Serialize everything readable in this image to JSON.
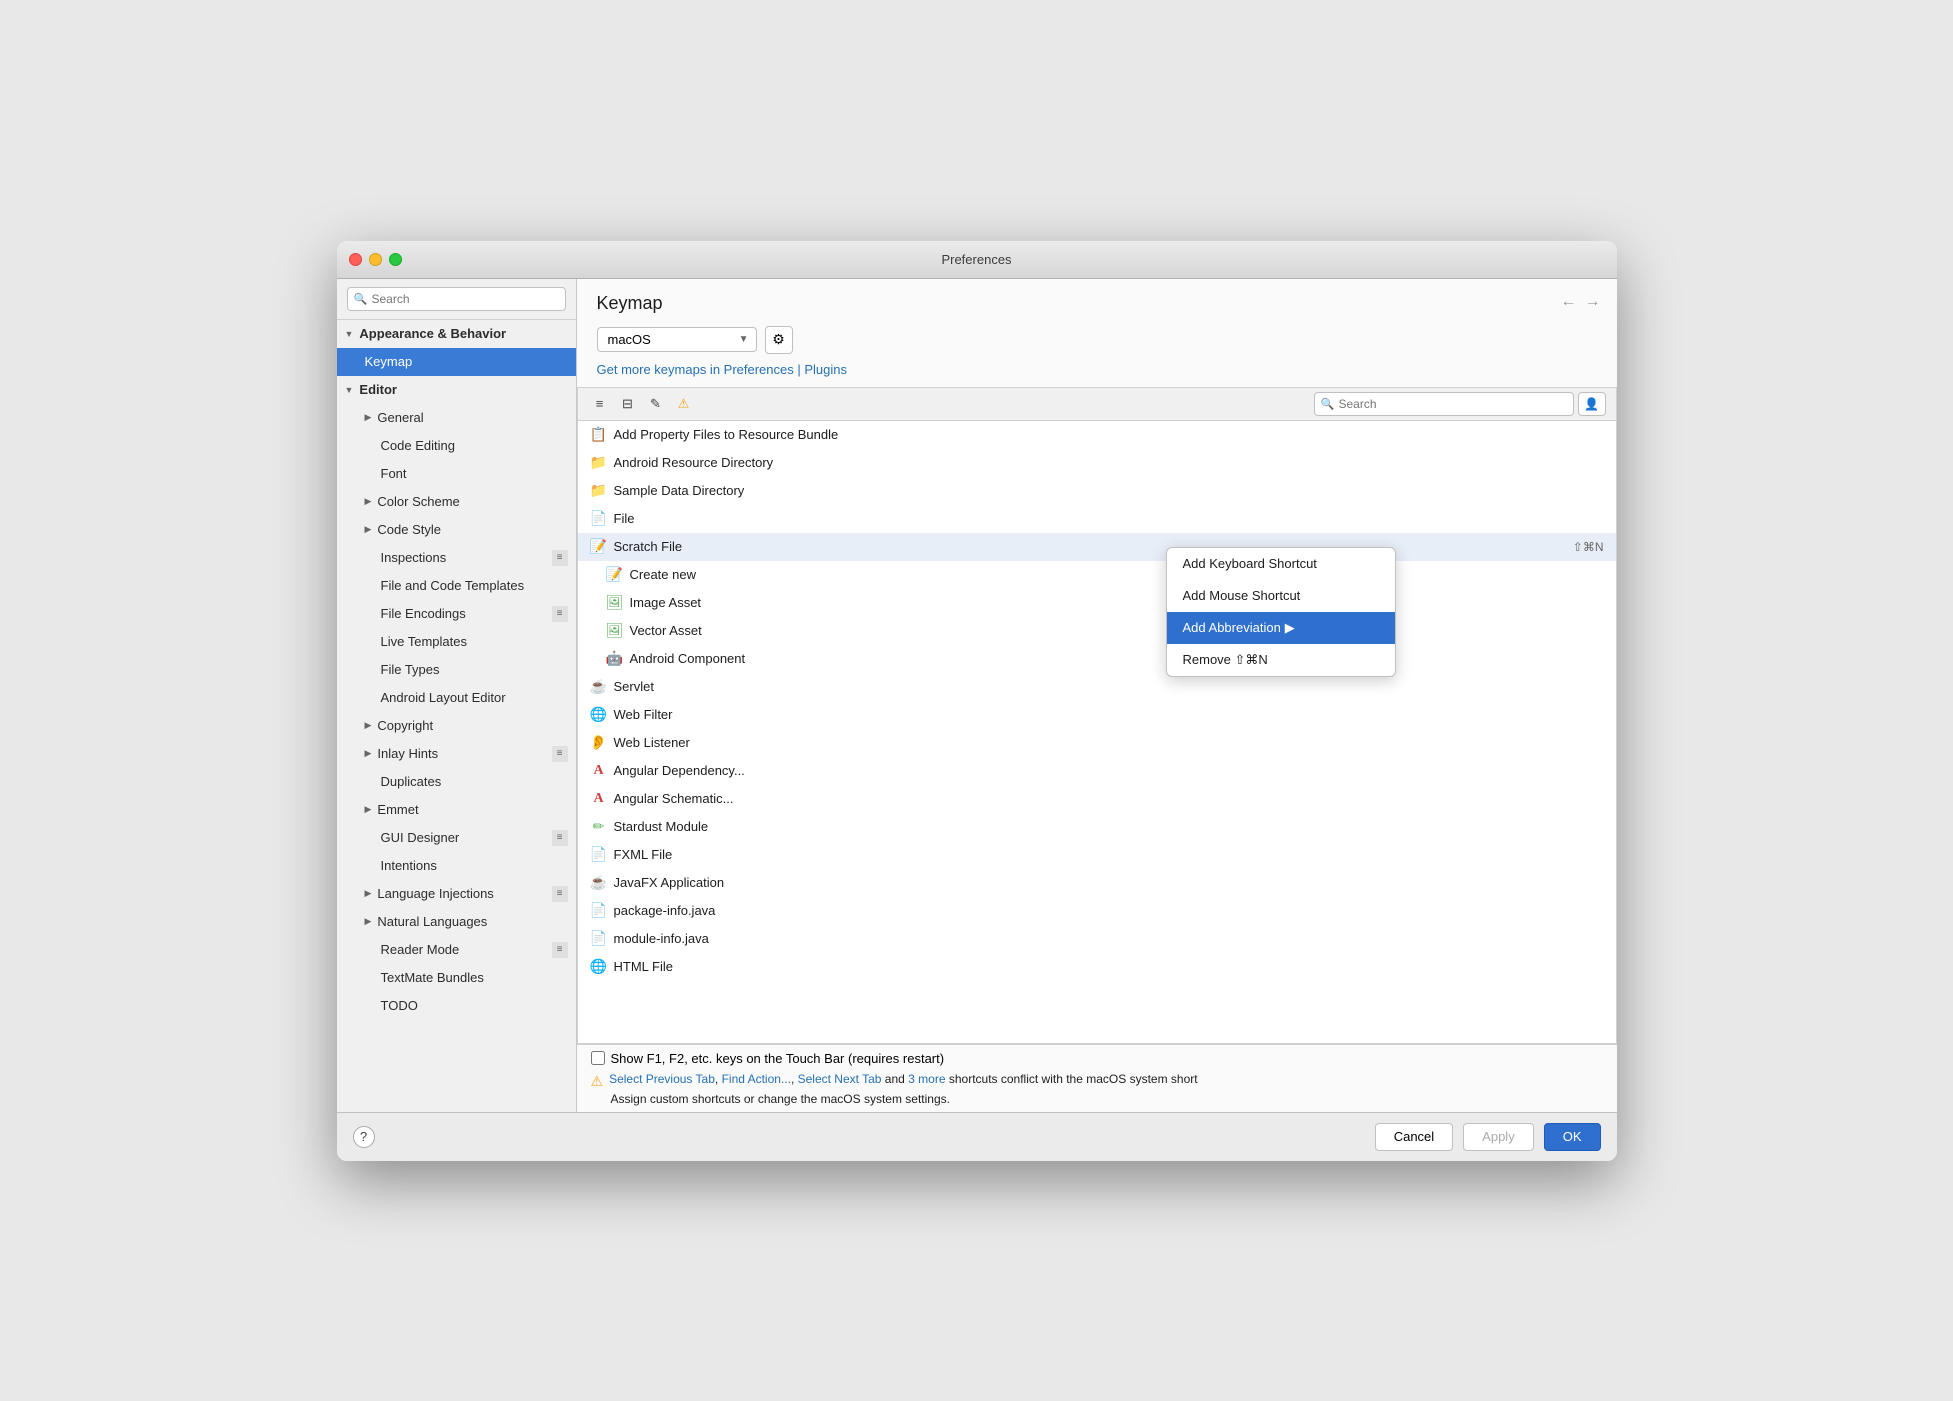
{
  "window": {
    "title": "Preferences"
  },
  "sidebar": {
    "search_placeholder": "Search",
    "items": [
      {
        "id": "appearance",
        "label": "Appearance & Behavior",
        "indent": 0,
        "type": "section",
        "expanded": true
      },
      {
        "id": "keymap",
        "label": "Keymap",
        "indent": 1,
        "type": "item",
        "active": true
      },
      {
        "id": "editor",
        "label": "Editor",
        "indent": 0,
        "type": "section",
        "expanded": true
      },
      {
        "id": "general",
        "label": "General",
        "indent": 1,
        "type": "subsection"
      },
      {
        "id": "code-editing",
        "label": "Code Editing",
        "indent": 2,
        "type": "item"
      },
      {
        "id": "font",
        "label": "Font",
        "indent": 2,
        "type": "item"
      },
      {
        "id": "color-scheme",
        "label": "Color Scheme",
        "indent": 1,
        "type": "subsection"
      },
      {
        "id": "code-style",
        "label": "Code Style",
        "indent": 1,
        "type": "subsection"
      },
      {
        "id": "inspections",
        "label": "Inspections",
        "indent": 2,
        "type": "item",
        "badge": true
      },
      {
        "id": "file-code-templates",
        "label": "File and Code Templates",
        "indent": 2,
        "type": "item"
      },
      {
        "id": "file-encodings",
        "label": "File Encodings",
        "indent": 2,
        "type": "item",
        "badge": true
      },
      {
        "id": "live-templates",
        "label": "Live Templates",
        "indent": 2,
        "type": "item"
      },
      {
        "id": "file-types",
        "label": "File Types",
        "indent": 2,
        "type": "item"
      },
      {
        "id": "android-layout",
        "label": "Android Layout Editor",
        "indent": 2,
        "type": "item"
      },
      {
        "id": "copyright",
        "label": "Copyright",
        "indent": 1,
        "type": "subsection"
      },
      {
        "id": "inlay-hints",
        "label": "Inlay Hints",
        "indent": 1,
        "type": "subsection",
        "badge": true
      },
      {
        "id": "duplicates",
        "label": "Duplicates",
        "indent": 2,
        "type": "item"
      },
      {
        "id": "emmet",
        "label": "Emmet",
        "indent": 1,
        "type": "subsection"
      },
      {
        "id": "gui-designer",
        "label": "GUI Designer",
        "indent": 2,
        "type": "item",
        "badge": true
      },
      {
        "id": "intentions",
        "label": "Intentions",
        "indent": 2,
        "type": "item"
      },
      {
        "id": "language-injections",
        "label": "Language Injections",
        "indent": 1,
        "type": "subsection",
        "badge": true
      },
      {
        "id": "natural-languages",
        "label": "Natural Languages",
        "indent": 1,
        "type": "subsection"
      },
      {
        "id": "reader-mode",
        "label": "Reader Mode",
        "indent": 2,
        "type": "item",
        "badge": true
      },
      {
        "id": "textmate-bundles",
        "label": "TextMate Bundles",
        "indent": 2,
        "type": "item"
      },
      {
        "id": "todo",
        "label": "TODO",
        "indent": 2,
        "type": "item"
      }
    ]
  },
  "content": {
    "title": "Keymap",
    "keymap_select_value": "macOS",
    "link_preferences": "Preferences",
    "link_plugins": "Plugins",
    "link_text": "Get more keymaps in Preferences | Plugins",
    "toolbar_search_placeholder": "Search",
    "list_items": [
      {
        "icon": "📋",
        "label": "Add Property Files to Resource Bundle",
        "shortcut": ""
      },
      {
        "icon": "📁",
        "label": "Android Resource Directory",
        "shortcut": ""
      },
      {
        "icon": "📁",
        "label": "Sample Data Directory",
        "shortcut": ""
      },
      {
        "icon": "📄",
        "label": "File",
        "shortcut": ""
      },
      {
        "icon": "📝",
        "label": "Scratch File",
        "shortcut": "⇧⌘N",
        "highlighted": true
      },
      {
        "icon": "📝",
        "label": "Create new",
        "shortcut": "",
        "indented": true
      },
      {
        "icon": "🖼️",
        "label": "Image Asset",
        "shortcut": "",
        "indented": true
      },
      {
        "icon": "🖼️",
        "label": "Vector Asset",
        "shortcut": "",
        "indented": true
      },
      {
        "icon": "🤖",
        "label": "Android Component",
        "shortcut": "",
        "indented": true
      },
      {
        "icon": "☕",
        "label": "Servlet",
        "shortcut": ""
      },
      {
        "icon": "🌐",
        "label": "Web Filter",
        "shortcut": ""
      },
      {
        "icon": "👂",
        "label": "Web Listener",
        "shortcut": ""
      },
      {
        "icon": "🅰️",
        "label": "Angular Dependency...",
        "shortcut": ""
      },
      {
        "icon": "🅰️",
        "label": "Angular Schematic...",
        "shortcut": ""
      },
      {
        "icon": "✏️",
        "label": "Stardust Module",
        "shortcut": ""
      },
      {
        "icon": "📄",
        "label": "FXML File",
        "shortcut": ""
      },
      {
        "icon": "☕",
        "label": "JavaFX Application",
        "shortcut": ""
      },
      {
        "icon": "📄",
        "label": "package-info.java",
        "shortcut": ""
      },
      {
        "icon": "📄",
        "label": "module-info.java",
        "shortcut": ""
      },
      {
        "icon": "🌐",
        "label": "HTML File",
        "shortcut": ""
      }
    ],
    "context_menu": {
      "items": [
        {
          "label": "Add Keyboard Shortcut",
          "active": false
        },
        {
          "label": "Add Mouse Shortcut",
          "active": false
        },
        {
          "label": "Add Abbreviation",
          "active": true
        },
        {
          "label": "Remove ⇧⌘N",
          "active": false
        }
      ]
    },
    "touch_bar_label": "Show F1, F2, etc. keys on the Touch Bar (requires restart)",
    "warning_text": "Select Previous Tab, Find Action..., Select Next Tab and 3 more shortcuts conflict with the macOS system short",
    "warning_text2": "Assign custom shortcuts or change the macOS system settings.",
    "warning_links": [
      "Select Previous Tab",
      "Find Action...",
      "Select Next Tab",
      "3 more"
    ]
  },
  "footer": {
    "cancel_label": "Cancel",
    "apply_label": "Apply",
    "ok_label": "OK"
  }
}
